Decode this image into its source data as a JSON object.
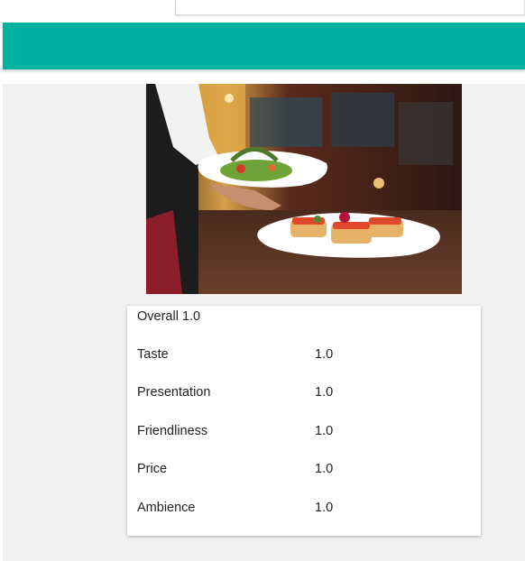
{
  "hero": {
    "image_subject": "waiter carrying two plates of food in a restaurant"
  },
  "ratings": {
    "overall_label": "Overall",
    "overall_value": "1.0",
    "items": [
      {
        "label": "Taste",
        "value": "1.0"
      },
      {
        "label": "Presentation",
        "value": "1.0"
      },
      {
        "label": "Friendliness",
        "value": "1.0"
      },
      {
        "label": "Price",
        "value": "1.0"
      },
      {
        "label": "Ambience",
        "value": "1.0"
      }
    ]
  },
  "colors": {
    "header": "#00b3a1",
    "background": "#f0f0f0",
    "card": "#ffffff"
  }
}
